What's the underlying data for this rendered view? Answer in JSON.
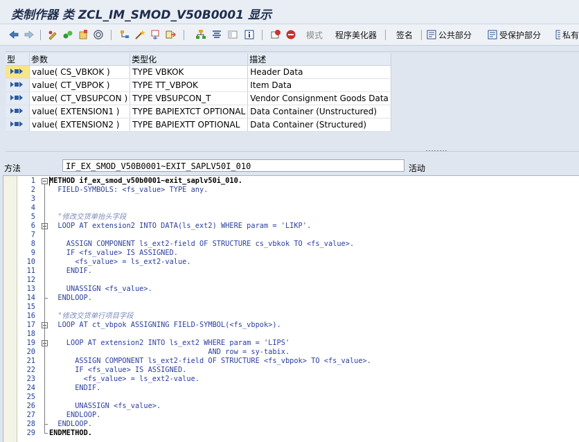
{
  "title": "类制作器 类 ZCL_IM_SMOD_V50B0001 显示",
  "toolbar": {
    "pattern_label": "模式",
    "pretty_printer_label": "程序美化器",
    "signature_label": "签名",
    "public_section_label": "公共部分",
    "protected_section_label": "受保护部分",
    "private_section_label": "私有"
  },
  "params": {
    "headers": {
      "type": "型",
      "param": "参数",
      "typing": "类型化",
      "desc": "描述"
    },
    "rows": [
      {
        "param": "value( CS_VBKOK )",
        "typing": "TYPE VBKOK",
        "desc": "Header Data"
      },
      {
        "param": "value( CT_VBPOK )",
        "typing": "TYPE TT_VBPOK",
        "desc": "Item Data"
      },
      {
        "param": "value( CT_VBSUPCON )",
        "typing": "TYPE VBSUPCON_T",
        "desc": "Vendor Consignment Goods Data"
      },
      {
        "param": "value( EXTENSION1 )",
        "typing": "TYPE BAPIEXTCT OPTIONAL",
        "desc": "Data Container (Unstructured)"
      },
      {
        "param": "value( EXTENSION2 )",
        "typing": "TYPE BAPIEXTT OPTIONAL",
        "desc": "Data Container (Structured)"
      }
    ]
  },
  "method": {
    "label": "方法",
    "value": "IF_EX_SMOD_V50B0001~EXIT_SAPLV50I_010",
    "status": "活动"
  },
  "code_lines": [
    "METHOD if_ex_smod_v50b0001~exit_saplv50i_010.",
    "  FIELD-SYMBOLS: <fs_value> TYPE any.",
    "",
    "",
    "  \"修改交货单抬头字段",
    "  LOOP AT extension2 INTO DATA(ls_ext2) WHERE param = 'LIKP'.",
    "",
    "    ASSIGN COMPONENT ls_ext2-field OF STRUCTURE cs_vbkok TO <fs_value>.",
    "    IF <fs_value> IS ASSIGNED.",
    "      <fs_value> = ls_ext2-value.",
    "    ENDIF.",
    "",
    "    UNASSIGN <fs_value>.",
    "  ENDLOOP.",
    "",
    "  \"修改交货单行项目字段",
    "  LOOP AT ct_vbpok ASSIGNING FIELD-SYMBOL(<fs_vbpok>).",
    "",
    "    LOOP AT extension2 INTO ls_ext2 WHERE param = 'LIPS'",
    "                                     AND row = sy-tabix.",
    "      ASSIGN COMPONENT ls_ext2-field OF STRUCTURE <fs_vbpok> TO <fs_value>.",
    "      IF <fs_value> IS ASSIGNED.",
    "        <fs_value> = ls_ext2-value.",
    "      ENDIF.",
    "",
    "      UNASSIGN <fs_value>.",
    "    ENDLOOP.",
    "  ENDLOOP.",
    "ENDMETHOD."
  ],
  "colors": {
    "code_keyword": "#2b3f9e",
    "comment": "#7b8ab8",
    "literal": "#2b3f9e",
    "line_number": "#1f3f9a"
  }
}
